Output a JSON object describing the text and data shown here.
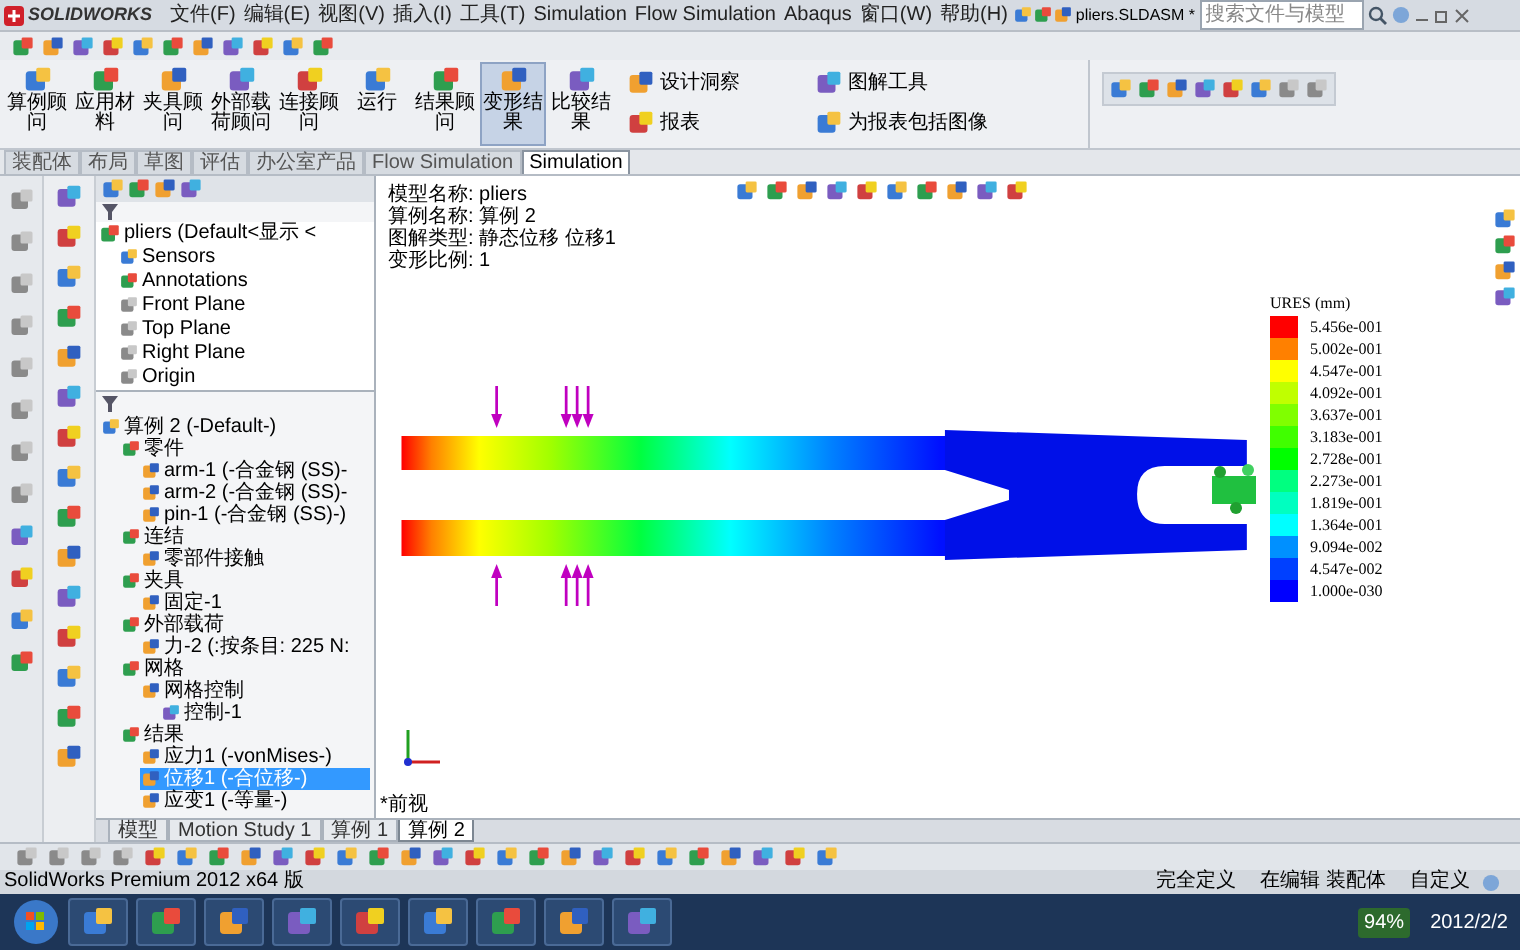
{
  "app_menu": {
    "logo": "SOLIDWORKS",
    "items": [
      "文件(F)",
      "编辑(E)",
      "视图(V)",
      "插入(I)",
      "工具(T)",
      "Simulation",
      "Flow Simulation",
      "Abaqus",
      "窗口(W)",
      "帮助(H)"
    ]
  },
  "document": {
    "filename": "pliers.SLDASM *"
  },
  "search": {
    "placeholder": "搜索文件与模型"
  },
  "ribbon": {
    "buttons": [
      {
        "label": "算例顾问",
        "selected": false
      },
      {
        "label": "应用材料",
        "selected": false
      },
      {
        "label": "夹具顾问",
        "selected": false
      },
      {
        "label": "外部载荷顾问",
        "selected": false
      },
      {
        "label": "连接顾问",
        "selected": false
      },
      {
        "label": "运行",
        "selected": false
      },
      {
        "label": "结果顾问",
        "selected": false
      },
      {
        "label": "变形结果",
        "selected": true
      },
      {
        "label": "比较结果",
        "selected": false
      }
    ],
    "side_buttons": [
      "设计洞察",
      "图解工具",
      "报表",
      "为报表包括图像"
    ]
  },
  "tabs": [
    {
      "label": "装配体",
      "selected": false
    },
    {
      "label": "布局",
      "selected": false
    },
    {
      "label": "草图",
      "selected": false
    },
    {
      "label": "评估",
      "selected": false
    },
    {
      "label": "办公室产品",
      "selected": false
    },
    {
      "label": "Flow Simulation",
      "selected": false
    },
    {
      "label": "Simulation",
      "selected": true
    }
  ],
  "feature_tree": {
    "root": "pliers (Default<显示 <",
    "items": [
      "Sensors",
      "Annotations",
      "Front Plane",
      "Top Plane",
      "Right Plane",
      "Origin"
    ]
  },
  "study_tree": {
    "label": "算例 2 (-Default-)",
    "selected": false,
    "children": [
      {
        "label": "零件",
        "selected": false,
        "children": [
          {
            "label": "arm-1 (-合金钢 (SS)-",
            "selected": false
          },
          {
            "label": "arm-2 (-合金钢 (SS)-",
            "selected": false
          },
          {
            "label": "pin-1 (-合金钢 (SS)-)",
            "selected": false
          }
        ]
      },
      {
        "label": "连结",
        "selected": false,
        "children": [
          {
            "label": "零部件接触",
            "selected": false
          }
        ]
      },
      {
        "label": "夹具",
        "selected": false,
        "children": [
          {
            "label": "固定-1",
            "selected": false
          }
        ]
      },
      {
        "label": "外部载荷",
        "selected": false,
        "children": [
          {
            "label": "力-2 (:按条目: 225 N:",
            "selected": false
          }
        ]
      },
      {
        "label": "网格",
        "selected": false,
        "children": [
          {
            "label": "网格控制",
            "selected": false,
            "children": [
              {
                "label": "控制-1",
                "selected": false
              }
            ]
          }
        ]
      },
      {
        "label": "结果",
        "selected": false,
        "children": [
          {
            "label": "应力1 (-vonMises-)",
            "selected": false
          },
          {
            "label": "位移1 (-合位移-)",
            "selected": true
          },
          {
            "label": "应变1 (-等量-)",
            "selected": false
          }
        ]
      }
    ]
  },
  "graphics": {
    "info": [
      "模型名称: pliers",
      "算例名称: 算例 2",
      "图解类型: 静态位移 位移1",
      "变形比例: 1"
    ],
    "legend": {
      "title": "URES (mm)",
      "items": [
        {
          "value": "5.456e-001",
          "color": "#ff0000"
        },
        {
          "value": "5.002e-001",
          "color": "#ff8000"
        },
        {
          "value": "4.547e-001",
          "color": "#ffff00"
        },
        {
          "value": "4.092e-001",
          "color": "#c0ff00"
        },
        {
          "value": "3.637e-001",
          "color": "#80ff00"
        },
        {
          "value": "3.183e-001",
          "color": "#40ff00"
        },
        {
          "value": "2.728e-001",
          "color": "#00ff00"
        },
        {
          "value": "2.273e-001",
          "color": "#00ff80"
        },
        {
          "value": "1.819e-001",
          "color": "#00ffc0"
        },
        {
          "value": "1.364e-001",
          "color": "#00ffff"
        },
        {
          "value": "9.094e-002",
          "color": "#0090ff"
        },
        {
          "value": "4.547e-002",
          "color": "#0040ff"
        },
        {
          "value": "1.000e-030",
          "color": "#0000ff"
        }
      ]
    },
    "view_label": "*前视"
  },
  "bottom_tabs": [
    {
      "label": "模型",
      "selected": false
    },
    {
      "label": "Motion Study 1",
      "selected": false
    },
    {
      "label": "算例 1",
      "selected": false
    },
    {
      "label": "算例 2",
      "selected": true
    }
  ],
  "status_bar": {
    "product": "SolidWorks Premium 2012 x64 版",
    "items": [
      "完全定义",
      "在编辑 装配体",
      "自定义"
    ]
  },
  "taskbar": {
    "battery": "94%",
    "date": "2012/2/2"
  }
}
